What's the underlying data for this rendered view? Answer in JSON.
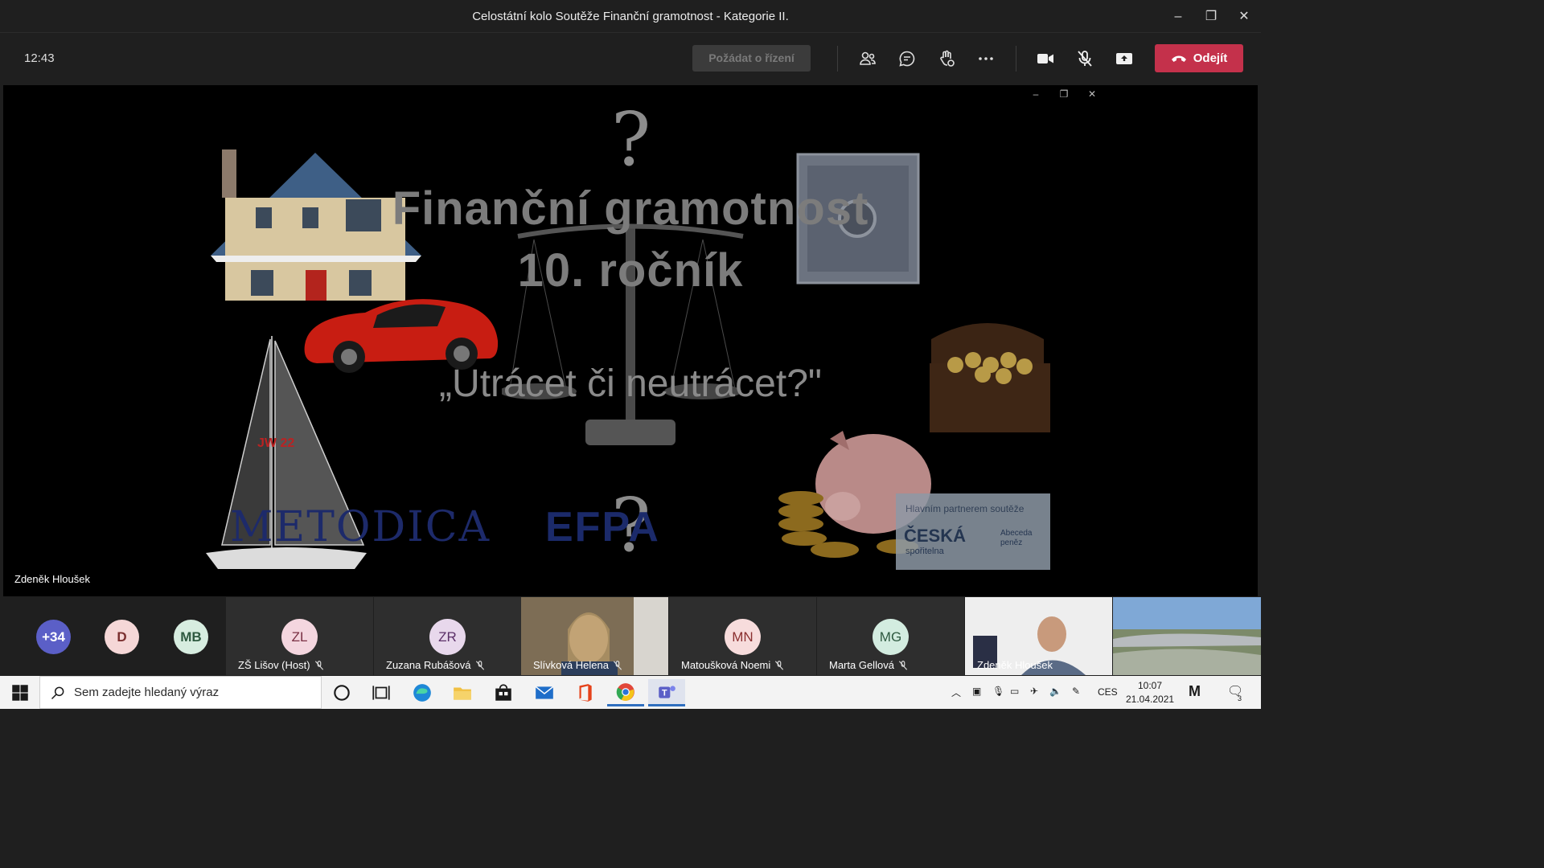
{
  "window": {
    "title": "Celostátní kolo Soutěže Finanční gramotnost - Kategorie II.",
    "minimize": "–",
    "maximize": "❐",
    "close": "✕"
  },
  "meeting": {
    "time": "12:43",
    "request_control": "Požádat o řízení",
    "leave": "Odejít",
    "icons": [
      "people-icon",
      "chat-icon",
      "reactions-icon",
      "more-icon",
      "camera-icon",
      "mic-off-icon",
      "share-icon"
    ]
  },
  "slide": {
    "title_line1": "Finanční gramotnost",
    "title_line2": "10. ročník",
    "subtitle": "„Utrácet či neutrácet?\"",
    "question_mark": "?",
    "logo_metodica": "METODICA",
    "logo_efpa": "EFPA",
    "partner_title": "Hlavním partnerem soutěže",
    "partner_brand": "ČESKÁ",
    "partner_sub": "spořitelna",
    "partner_abc_1": "Abeceda",
    "partner_abc_2": "peněz",
    "presenter": "Zdeněk Hloušek"
  },
  "participants": {
    "overflow": "+34",
    "mini": [
      {
        "initials": "D",
        "bg": "#f5d7d7",
        "fg": "#7a2f2f"
      },
      {
        "initials": "MB",
        "bg": "#d7ede0",
        "fg": "#2f5a41"
      }
    ],
    "tiles": [
      {
        "initials": "ZL",
        "name": "ZŠ Lišov (Host)",
        "bg": "#f4d6df",
        "fg": "#7a3044"
      },
      {
        "initials": "ZR",
        "name": "Zuzana Rubášová",
        "bg": "#e8d8ec",
        "fg": "#5b2f68"
      },
      {
        "initials": "",
        "name": "Slívková Helena",
        "video": true
      },
      {
        "initials": "MN",
        "name": "Matoušková Noemi",
        "bg": "#f7dcdc",
        "fg": "#8a2f2f"
      },
      {
        "initials": "MG",
        "name": "Marta Gellová",
        "bg": "#d3ece0",
        "fg": "#2f5a41"
      },
      {
        "initials": "",
        "name": "Zdeněk Hloušek",
        "video": true
      }
    ]
  },
  "taskbar": {
    "search_placeholder": "Sem zadejte hledaný výraz",
    "lang": "CES",
    "time": "10:07",
    "date": "21.04.2021",
    "notifications": "3"
  }
}
